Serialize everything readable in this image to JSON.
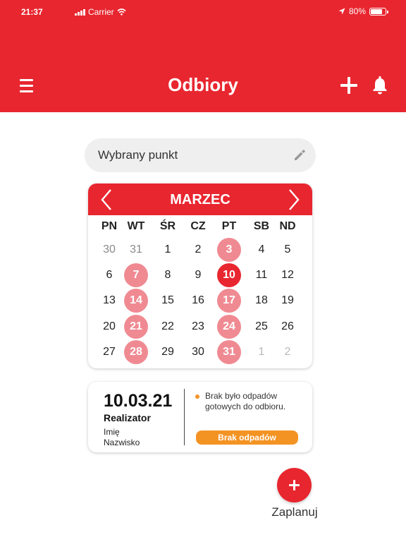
{
  "status_bar": {
    "time": "21:37",
    "carrier": "Carrier",
    "battery": "80%",
    "battery_level": 0.8
  },
  "header": {
    "title": "Odbiory",
    "menu_icon": "hamburger-menu-icon",
    "add_icon": "plus-icon",
    "notifications_icon": "bell-icon",
    "background_color": "#e8262f"
  },
  "point_selector": {
    "label": "Wybrany punkt",
    "icon": "pencil-icon"
  },
  "calendar": {
    "month": "MARZEC",
    "weekdays": [
      "PN",
      "WT",
      "ŚR",
      "CZ",
      "PT",
      "SB",
      "ND"
    ],
    "weeks": [
      [
        {
          "d": "30",
          "s": "muted"
        },
        {
          "d": "31",
          "s": "muted"
        },
        {
          "d": "1"
        },
        {
          "d": "2"
        },
        {
          "d": "3",
          "s": "pickup"
        },
        {
          "d": "4"
        },
        {
          "d": "5"
        }
      ],
      [
        {
          "d": "6"
        },
        {
          "d": "7",
          "s": "pickup"
        },
        {
          "d": "8"
        },
        {
          "d": "9"
        },
        {
          "d": "10",
          "s": "today"
        },
        {
          "d": "11"
        },
        {
          "d": "12"
        }
      ],
      [
        {
          "d": "13"
        },
        {
          "d": "14",
          "s": "pickup"
        },
        {
          "d": "15"
        },
        {
          "d": "16"
        },
        {
          "d": "17",
          "s": "pickup"
        },
        {
          "d": "18"
        },
        {
          "d": "19"
        }
      ],
      [
        {
          "d": "20"
        },
        {
          "d": "21",
          "s": "pickup"
        },
        {
          "d": "22"
        },
        {
          "d": "23"
        },
        {
          "d": "24",
          "s": "pickup"
        },
        {
          "d": "25"
        },
        {
          "d": "26"
        }
      ],
      [
        {
          "d": "27"
        },
        {
          "d": "28",
          "s": "pickup"
        },
        {
          "d": "29"
        },
        {
          "d": "30"
        },
        {
          "d": "31",
          "s": "pickup"
        },
        {
          "d": "1",
          "s": "faded"
        },
        {
          "d": "2",
          "s": "faded"
        }
      ]
    ],
    "pickup_color": "#f08a92",
    "selected_color": "#e8262f"
  },
  "pickup_info": {
    "date": "10.03.21",
    "role": "Realizator",
    "first_name": "Imię",
    "last_name": "Nazwisko",
    "message": "Brak było odpadów gotowych do odbioru.",
    "status_badge": "Brak odpadów",
    "status_color": "#f39323"
  },
  "fab": {
    "icon": "plus-icon",
    "label": "Zaplanuj"
  }
}
